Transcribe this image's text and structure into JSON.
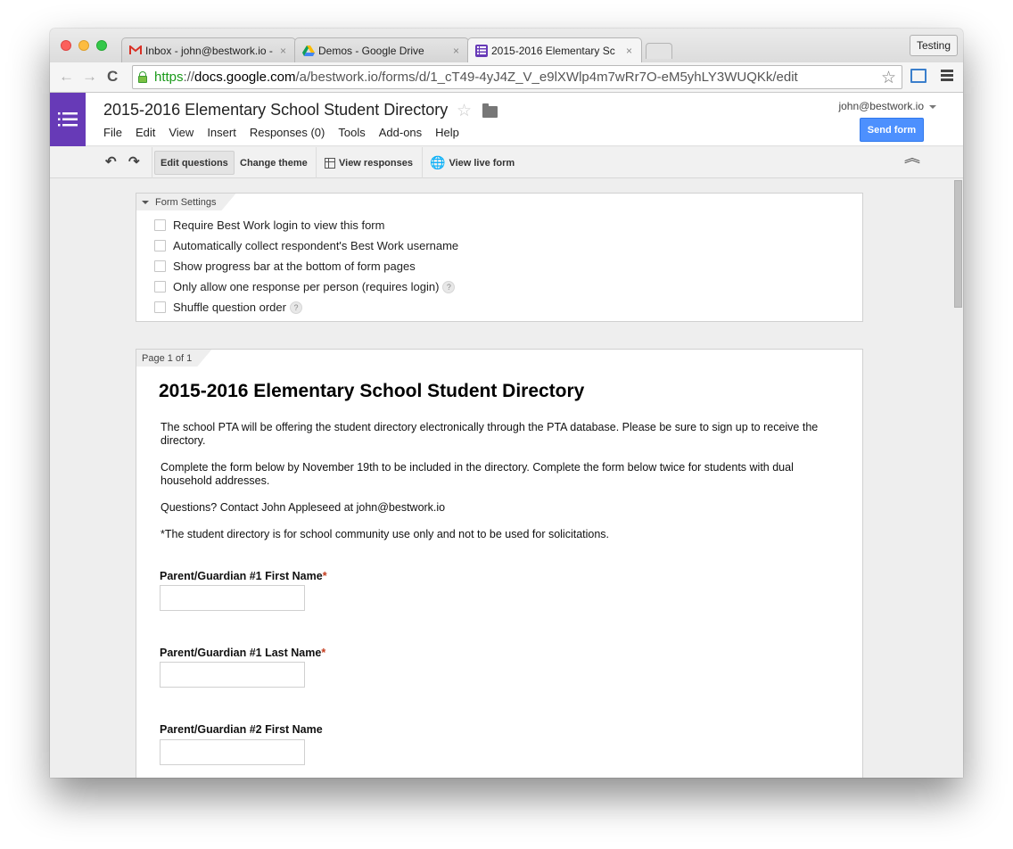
{
  "browser": {
    "tabs": [
      {
        "title": "Inbox - john@bestwork.io - ",
        "icon": "gmail-icon",
        "active": false
      },
      {
        "title": "Demos - Google Drive",
        "icon": "google-drive-icon",
        "active": false
      },
      {
        "title": "2015-2016 Elementary Sc",
        "icon": "google-forms-icon",
        "active": true
      }
    ],
    "close_glyph": "×",
    "profile_label": "Testing",
    "url": {
      "scheme": "https",
      "sep": "://",
      "host": "docs.google.com",
      "path": "/a/bestwork.io/forms/d/1_cT49-4yJ4Z_V_e9lXWlp4m7wRr7O-eM5yhLY3WUQKk/edit"
    },
    "nav": {
      "back": "←",
      "forward": "→",
      "reload": "C"
    },
    "bookmark_star": "☆"
  },
  "app": {
    "doc_title": "2015-2016 Elementary School Student Directory",
    "star_glyph": "☆",
    "menu": [
      "File",
      "Edit",
      "View",
      "Insert",
      "Responses (0)",
      "Tools",
      "Add-ons",
      "Help"
    ],
    "account": "john@bestwork.io",
    "send_button": "Send form"
  },
  "toolbar": {
    "undo": "↶",
    "redo": "↷",
    "edit_questions": "Edit questions",
    "change_theme": "Change theme",
    "view_responses": "View responses",
    "view_live_form": "View live form",
    "collapse": "︽"
  },
  "settings": {
    "tab_label": "Form Settings",
    "options": [
      {
        "label": "Require Best Work login to view this form",
        "checked": false,
        "help": false
      },
      {
        "label": "Automatically collect respondent's Best Work username",
        "checked": false,
        "help": false
      },
      {
        "label": "Show progress bar at the bottom of form pages",
        "checked": false,
        "help": false
      },
      {
        "label": "Only allow one response per person (requires login)",
        "checked": false,
        "help": true
      },
      {
        "label": "Shuffle question order",
        "checked": false,
        "help": true
      }
    ],
    "help_glyph": "?"
  },
  "page": {
    "tab_label": "Page 1 of 1",
    "form_title": "2015-2016 Elementary School Student Directory",
    "description": [
      "The school PTA will be offering the student directory electronically through the PTA database.  Please be sure to sign up to receive the directory.",
      "Complete the form below by November 19th to be included in the directory.  Complete the form below twice for students with dual household addresses.",
      "Questions? Contact John Appleseed at john@bestwork.io",
      "*The student directory is for school community use only and not to be used for solicitations."
    ],
    "questions": [
      {
        "label": "Parent/Guardian #1 First Name",
        "required": true,
        "value": ""
      },
      {
        "label": "Parent/Guardian #1 Last Name",
        "required": true,
        "value": ""
      },
      {
        "label": "Parent/Guardian #2 First Name",
        "required": false,
        "value": ""
      }
    ],
    "required_mark": "*"
  }
}
